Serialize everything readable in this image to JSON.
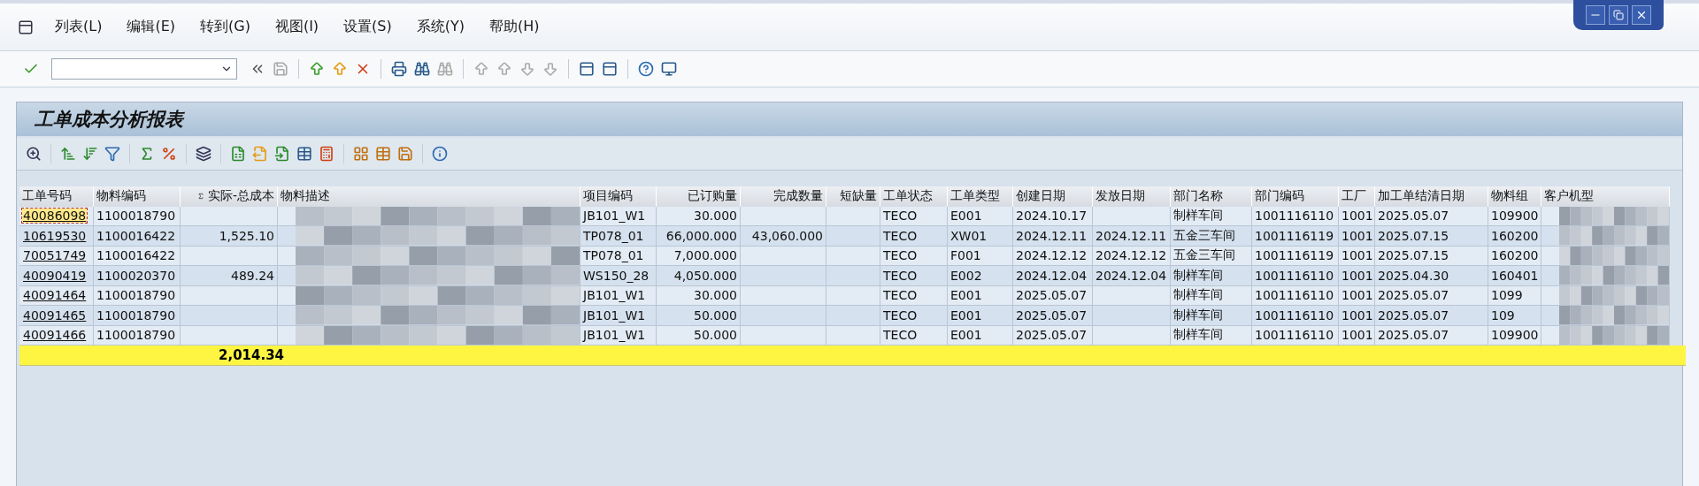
{
  "menu": [
    "列表(L)",
    "编辑(E)",
    "转到(G)",
    "视图(I)",
    "设置(S)",
    "系统(Y)",
    "帮助(H)"
  ],
  "title": "工单成本分析报表",
  "table": {
    "columns": [
      {
        "label": "工单号码",
        "kind": "link"
      },
      {
        "label": "物料编码",
        "kind": "text"
      },
      {
        "label": "实际-总成本",
        "kind": "sum"
      },
      {
        "label": "物料描述",
        "kind": "masked"
      },
      {
        "label": "项目编码",
        "kind": "text"
      },
      {
        "label": "已订购量",
        "kind": "number"
      },
      {
        "label": "完成数量",
        "kind": "number"
      },
      {
        "label": "短缺量",
        "kind": "number"
      },
      {
        "label": "工单状态",
        "kind": "text"
      },
      {
        "label": "工单类型",
        "kind": "text"
      },
      {
        "label": "创建日期",
        "kind": "text"
      },
      {
        "label": "发放日期",
        "kind": "text"
      },
      {
        "label": "部门名称",
        "kind": "text"
      },
      {
        "label": "部门编码",
        "kind": "text"
      },
      {
        "label": "工厂",
        "kind": "text"
      },
      {
        "label": "加工单结清日期",
        "kind": "text"
      },
      {
        "label": "物料组",
        "kind": "text"
      },
      {
        "label": "客户机型",
        "kind": "masked"
      }
    ],
    "rows": [
      {
        "selected": true,
        "cells": [
          "40086098",
          "1100018790",
          "",
          "",
          "JB101_W1",
          "30.000",
          "",
          "",
          "TECO",
          "E001",
          "2024.10.17",
          "",
          "制样车间",
          "1001116110",
          "1001",
          "2025.05.07",
          "109900",
          ""
        ]
      },
      {
        "selected": false,
        "cells": [
          "10619530",
          "1100016422",
          "1,525.10",
          "",
          "TP078_01",
          "66,000.000",
          "43,060.000",
          "",
          "TECO",
          "XW01",
          "2024.12.11",
          "2024.12.11",
          "五金三车间",
          "1001116119",
          "1001",
          "2025.07.15",
          "160200",
          ""
        ]
      },
      {
        "selected": false,
        "cells": [
          "70051749",
          "1100016422",
          "",
          "",
          "TP078_01",
          "7,000.000",
          "",
          "",
          "TECO",
          "F001",
          "2024.12.12",
          "2024.12.12",
          "五金三车间",
          "1001116119",
          "1001",
          "2025.07.15",
          "160200",
          ""
        ]
      },
      {
        "selected": false,
        "cells": [
          "40090419",
          "1100020370",
          "489.24",
          "",
          "WS150_28",
          "4,050.000",
          "",
          "",
          "TECO",
          "E002",
          "2024.12.04",
          "2024.12.04",
          "制样车间",
          "1001116110",
          "1001",
          "2025.04.30",
          "160401",
          ""
        ]
      },
      {
        "selected": false,
        "cells": [
          "40091464",
          "1100018790",
          "",
          "",
          "JB101_W1",
          "30.000",
          "",
          "",
          "TECO",
          "E001",
          "2025.05.07",
          "",
          "制样车间",
          "1001116110",
          "1001",
          "2025.05.07",
          "1099",
          ""
        ]
      },
      {
        "selected": false,
        "cells": [
          "40091465",
          "1100018790",
          "",
          "",
          "JB101_W1",
          "50.000",
          "",
          "",
          "TECO",
          "E001",
          "2025.05.07",
          "",
          "制样车间",
          "1001116110",
          "1001",
          "2025.05.07",
          "109",
          ""
        ]
      },
      {
        "selected": false,
        "cells": [
          "40091466",
          "1100018790",
          "",
          "",
          "JB101_W1",
          "50.000",
          "",
          "",
          "TECO",
          "E001",
          "2025.05.07",
          "",
          "制样车间",
          "1001116110",
          "1001",
          "2025.05.07",
          "109900",
          ""
        ]
      }
    ],
    "total": "2,014.34"
  }
}
